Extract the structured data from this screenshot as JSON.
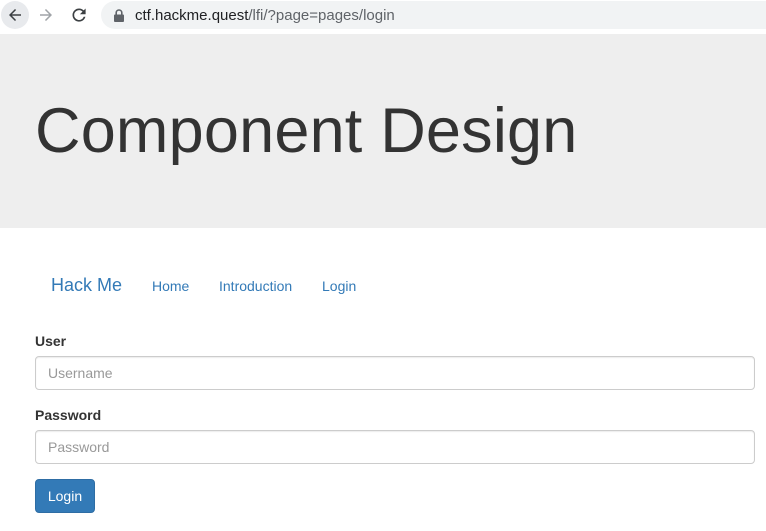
{
  "browser": {
    "url_host": "ctf.hackme.quest",
    "url_path": "/lfi/?page=pages/login",
    "icons": [
      "back-arrow-icon",
      "forward-arrow-icon",
      "reload-icon",
      "lock-icon"
    ]
  },
  "jumbotron": {
    "title": "Component Design"
  },
  "navbar": {
    "brand": "Hack Me",
    "items": [
      {
        "label": "Home"
      },
      {
        "label": "Introduction"
      },
      {
        "label": "Login"
      }
    ]
  },
  "login_form": {
    "user_label": "User",
    "user_placeholder": "Username",
    "user_value": "",
    "password_label": "Password",
    "password_placeholder": "Password",
    "password_value": "",
    "submit_label": "Login"
  },
  "colors": {
    "link": "#337ab7",
    "button_bg": "#337ab7",
    "jumbotron_bg": "#eeeeee",
    "omnibox_bg": "#f1f3f4"
  }
}
